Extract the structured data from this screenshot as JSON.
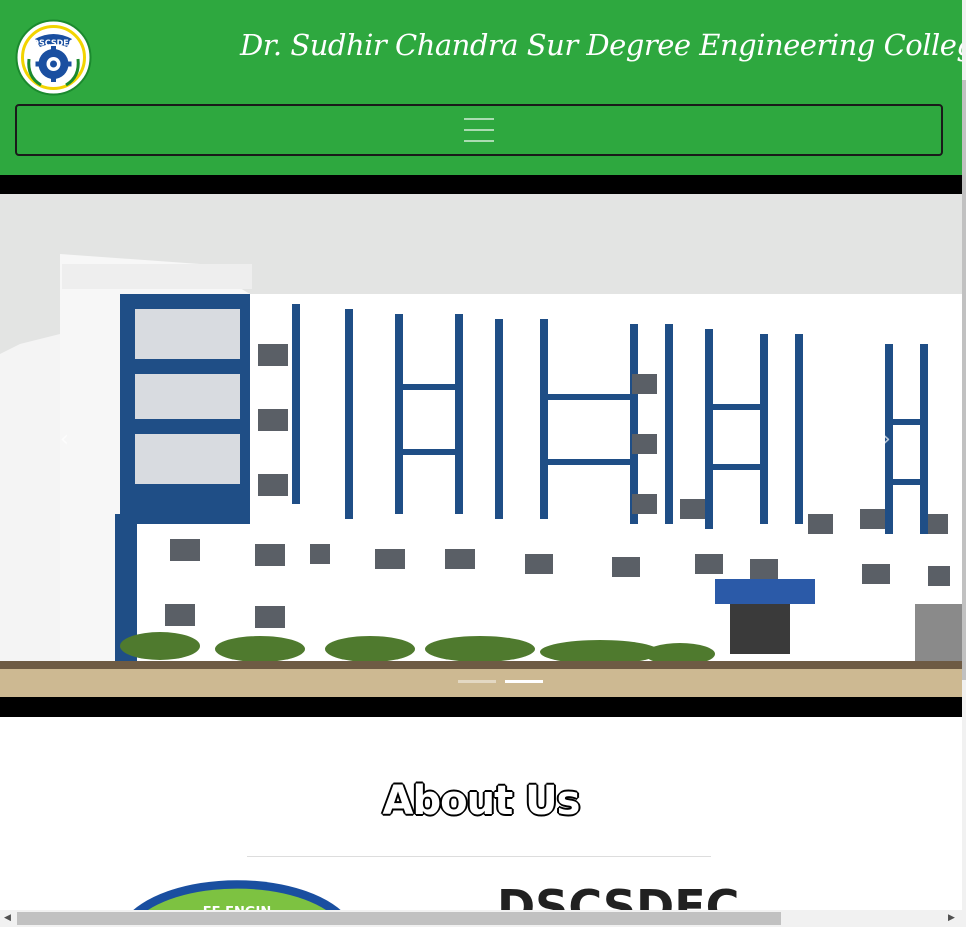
{
  "header": {
    "logo_text": "DSCSDEC",
    "college_name": "Dr. Sudhir Chandra Sur Degree Engineering College",
    "nav_toggle_icon": "hamburger-icon"
  },
  "carousel": {
    "prev_icon": "chevron-left-icon",
    "next_icon": "chevron-right-icon",
    "prev_glyph": "‹",
    "next_glyph": "›",
    "slide_count": 2,
    "active_slide": 2,
    "slide_description_icon": "college-building-photo"
  },
  "about": {
    "title": "About Us",
    "heading": "DSCSDEC",
    "logo_text": "EE ENGIN"
  },
  "colors": {
    "header_green": "#2ea83f",
    "carousel_bg": "#000000"
  }
}
